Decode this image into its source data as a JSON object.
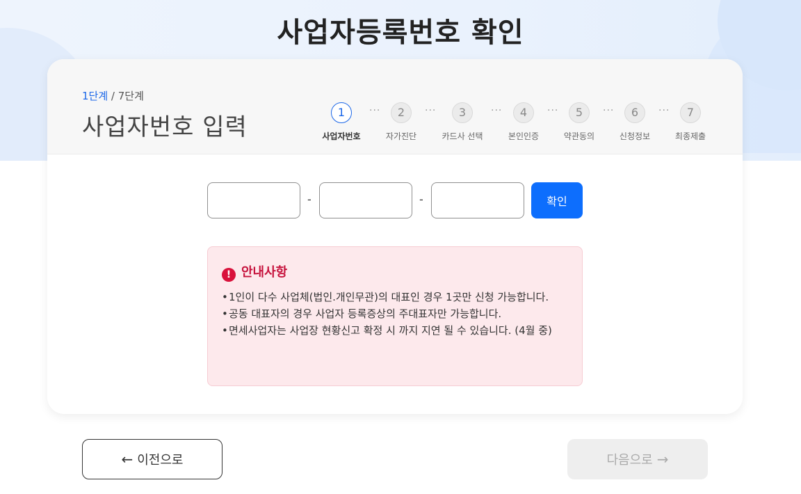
{
  "header": {
    "title": "사업자등록번호 확인"
  },
  "progress": {
    "current": "1단계",
    "separator": " / ",
    "total": "7단계",
    "section_title": "사업자번호 입력",
    "steps": [
      {
        "num": "1",
        "label": "사업자번호",
        "active": true
      },
      {
        "num": "2",
        "label": "자가진단"
      },
      {
        "num": "3",
        "label": "카드사 선택"
      },
      {
        "num": "4",
        "label": "본인인증"
      },
      {
        "num": "5",
        "label": "약관동의"
      },
      {
        "num": "6",
        "label": "신청정보"
      },
      {
        "num": "7",
        "label": "최종제출"
      }
    ],
    "dots": "···"
  },
  "form": {
    "field1_value": "",
    "field2_value": "",
    "field3_value": "",
    "dash": "-",
    "confirm_label": "확인"
  },
  "notice": {
    "icon": "alert-circle-icon",
    "title": "안내사항",
    "items": [
      "1인이 다수 사업체(법인.개인무관)의 대표인 경우 1곳만 신청 가능합니다.",
      "공동 대표자의 경우 사업자 등록증상의 주대표자만 가능합니다.",
      "면세사업자는 사업장 현황신고 확정 시 까지 지연 될 수 있습니다. (4월 중)"
    ]
  },
  "footer": {
    "prev_label": "이전으로",
    "next_label": "다음으로"
  },
  "colors": {
    "accent": "#0d6efd",
    "notice_bg": "#fde9ec",
    "notice_title": "#c6123c"
  }
}
